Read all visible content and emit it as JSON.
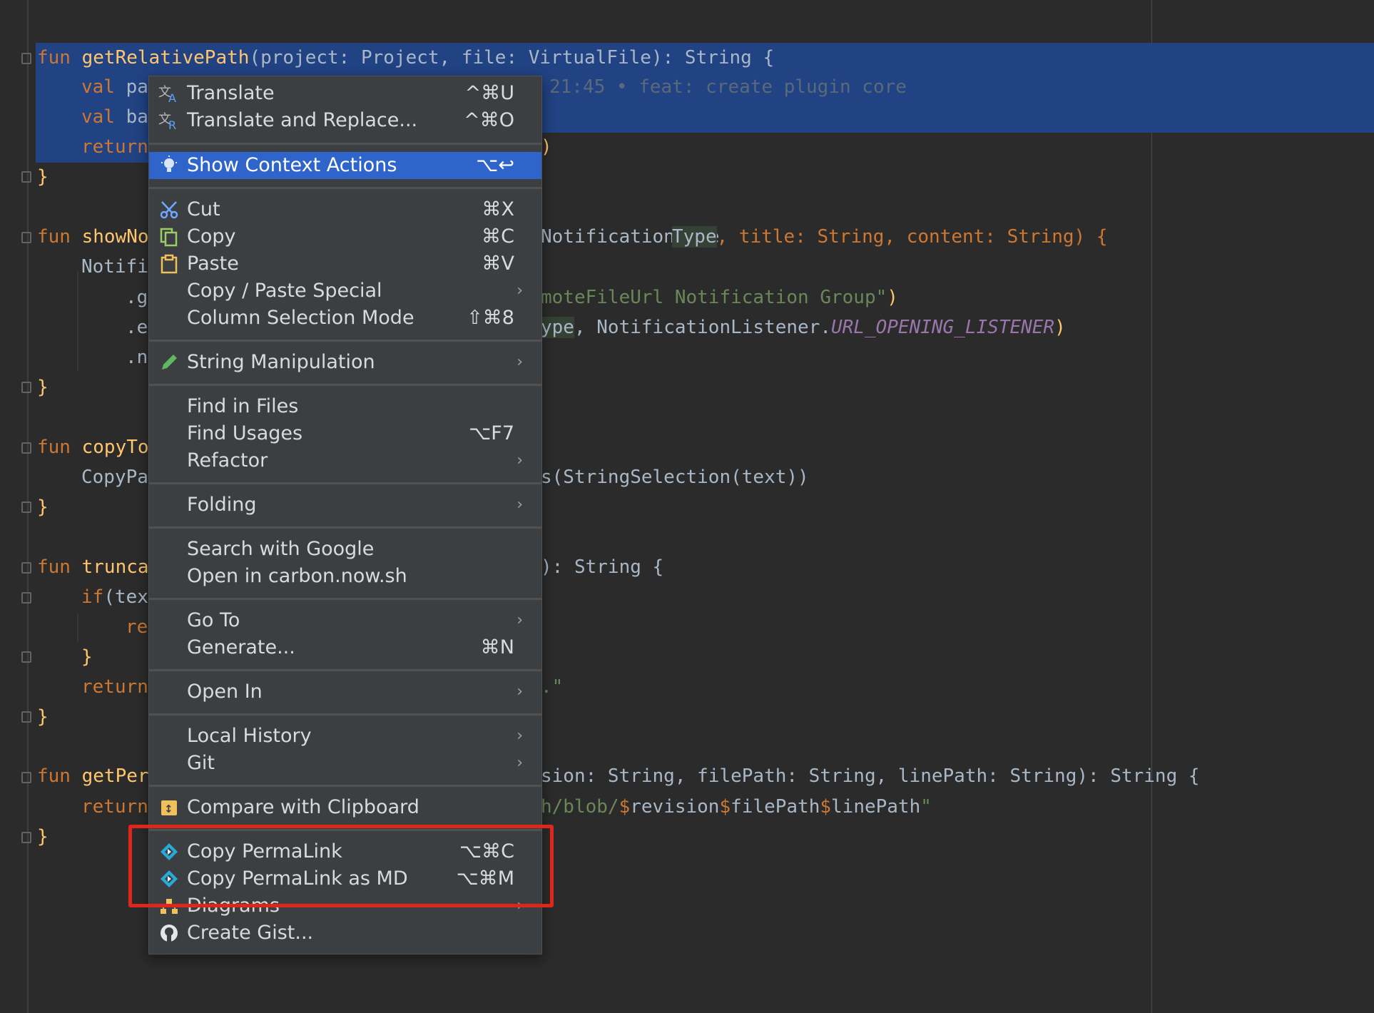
{
  "code": {
    "lines": [
      {
        "parts": [
          [
            "kw",
            "fun "
          ],
          [
            "fn",
            "getRelativePath"
          ],
          [
            "p",
            "(project: Project, file: VirtualFile): String {"
          ]
        ]
      },
      {
        "parts": [
          [
            "kw",
            "val "
          ],
          [
            "p",
            "pa"
          ]
        ]
      },
      {
        "parts": [
          [
            "kw",
            "val "
          ],
          [
            "p",
            "ba"
          ]
        ]
      },
      {
        "parts": [
          [
            "kw",
            "return"
          ]
        ]
      },
      {
        "parts": [
          [
            "p",
            "}"
          ]
        ]
      },
      {
        "parts": [
          [
            "kw",
            "fun "
          ],
          [
            "fn",
            "showNo"
          ]
        ]
      },
      {
        "parts": [
          [
            "p",
            "Notifi"
          ]
        ]
      },
      {
        "parts": [
          [
            "p",
            ".g"
          ]
        ]
      },
      {
        "parts": [
          [
            "p",
            ".e"
          ]
        ]
      },
      {
        "parts": [
          [
            "p",
            ".n"
          ]
        ]
      },
      {
        "parts": [
          [
            "p",
            "}"
          ]
        ]
      },
      {
        "parts": [
          [
            "kw",
            "fun "
          ],
          [
            "fn",
            "copyTo"
          ]
        ]
      },
      {
        "parts": [
          [
            "p",
            "CopyPa"
          ]
        ]
      },
      {
        "parts": [
          [
            "p",
            "}"
          ]
        ]
      },
      {
        "parts": [
          [
            "kw",
            "fun "
          ],
          [
            "fn",
            "trunca"
          ]
        ]
      },
      {
        "parts": [
          [
            "kw",
            "if"
          ],
          [
            "p",
            "(tex"
          ]
        ]
      },
      {
        "parts": [
          [
            "kw",
            "re"
          ]
        ]
      },
      {
        "parts": [
          [
            "p",
            "}"
          ]
        ]
      },
      {
        "parts": [
          [
            "kw",
            "return"
          ]
        ]
      },
      {
        "parts": [
          [
            "p",
            "}"
          ]
        ]
      },
      {
        "parts": [
          [
            "kw",
            "fun "
          ],
          [
            "fn",
            "getPer"
          ]
        ]
      },
      {
        "parts": [
          [
            "kw",
            "return"
          ]
        ]
      },
      {
        "parts": [
          [
            "p",
            "}"
          ]
        ]
      }
    ],
    "right": {
      "blame": "21:45 • feat: create plugin core",
      "r_return": ")",
      "r_show_a": "NotificationType",
      "r_show_hl": "Type",
      "r_show_b": ", title: String, content: String) {",
      "r_group_a": "moteFileUrl Notification Group\"",
      "r_group_b": ")",
      "r_listener_hl": "ype",
      "r_listener_b": ", NotificationListener.",
      "r_listener_c": "URL_OPENING_LISTENER",
      "r_listener_d": ")",
      "r_copy": "s(StringSelection(text))",
      "r_trunc": "): String {",
      "r_return2": ".\"",
      "r_getper": "sion: String, filePath: String, linePath: String): String {",
      "r_return3_a": "h/blob/",
      "r_return3_b": "$",
      "r_return3_c": "revision",
      "r_return3_d": "$",
      "r_return3_e": "filePath",
      "r_return3_f": "$",
      "r_return3_g": "linePath",
      "r_return3_h": "\""
    }
  },
  "menu": {
    "items": [
      {
        "label": "Translate",
        "shortcut": "^⌘U",
        "icon": "translate-icon"
      },
      {
        "label": "Translate and Replace...",
        "shortcut": "^⌘O",
        "icon": "translate-replace-icon"
      },
      {
        "label": "Show Context Actions",
        "shortcut": "⌥↩",
        "icon": "lightbulb-icon"
      },
      {
        "label": "Cut",
        "shortcut": "⌘X",
        "icon": "scissors-icon"
      },
      {
        "label": "Copy",
        "shortcut": "⌘C",
        "icon": "copy-icon"
      },
      {
        "label": "Paste",
        "shortcut": "⌘V",
        "icon": "clipboard-icon"
      },
      {
        "label": "Copy / Paste Special",
        "shortcut": "",
        "submenu": "›"
      },
      {
        "label": "Column Selection Mode",
        "shortcut": "⇧⌘8"
      },
      {
        "label": "String Manipulation",
        "shortcut": "",
        "submenu": "›",
        "icon": "pencil-icon"
      },
      {
        "label": "Find in Files",
        "shortcut": ""
      },
      {
        "label": "Find Usages",
        "shortcut": "⌥F7"
      },
      {
        "label": "Refactor",
        "shortcut": "",
        "submenu": "›"
      },
      {
        "label": "Folding",
        "shortcut": "",
        "submenu": "›"
      },
      {
        "label": "Search with Google",
        "shortcut": ""
      },
      {
        "label": "Open in carbon.now.sh",
        "shortcut": ""
      },
      {
        "label": "Go To",
        "shortcut": "",
        "submenu": "›"
      },
      {
        "label": "Generate...",
        "shortcut": "⌘N"
      },
      {
        "label": "Open In",
        "shortcut": "",
        "submenu": "›"
      },
      {
        "label": "Local History",
        "shortcut": "",
        "submenu": "›"
      },
      {
        "label": "Git",
        "shortcut": "",
        "submenu": "›"
      },
      {
        "label": "Compare with Clipboard",
        "shortcut": "",
        "icon": "compare-icon"
      },
      {
        "label": "Copy PermaLink",
        "shortcut": "⌥⌘C",
        "icon": "git-permalink-icon"
      },
      {
        "label": "Copy PermaLink as MD",
        "shortcut": "⌥⌘M",
        "icon": "git-permalink-icon"
      },
      {
        "label": "Diagrams",
        "shortcut": "",
        "submenu": "›",
        "icon": "diagram-icon"
      },
      {
        "label": "Create Gist...",
        "shortcut": "",
        "icon": "github-icon"
      }
    ]
  },
  "colors": {
    "editor_bg": "#2b2b2b",
    "selection": "#214283",
    "menu_bg": "#3c3f41",
    "menu_selected": "#2f65ca",
    "annotation_box": "#e0261a"
  }
}
